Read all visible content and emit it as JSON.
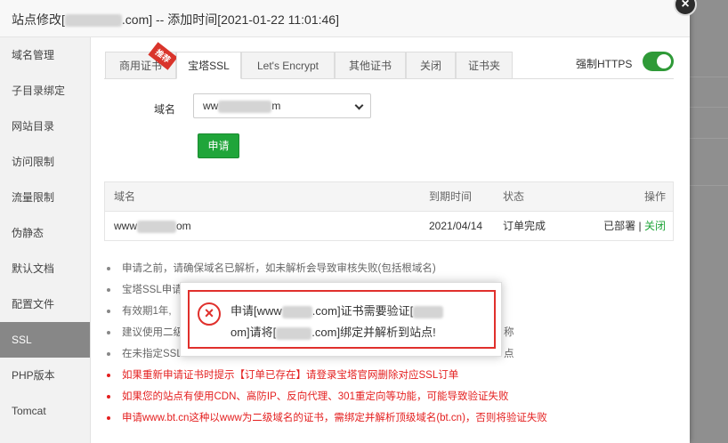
{
  "dialog": {
    "title_prefix": "站点修改[",
    "title_suffix": ".com] -- 添加时间[2021-01-22 11:01:46]",
    "close_glyph": "×"
  },
  "sidebar": {
    "items": [
      {
        "label": "域名管理"
      },
      {
        "label": "子目录绑定"
      },
      {
        "label": "网站目录"
      },
      {
        "label": "访问限制"
      },
      {
        "label": "流量限制"
      },
      {
        "label": "伪静态"
      },
      {
        "label": "默认文档"
      },
      {
        "label": "配置文件"
      },
      {
        "label": "SSL"
      },
      {
        "label": "PHP版本"
      },
      {
        "label": "Tomcat"
      }
    ],
    "active": "SSL"
  },
  "tabs": {
    "items": [
      {
        "label": "商用证书"
      },
      {
        "label": "宝塔SSL"
      },
      {
        "label": "Let's Encrypt"
      },
      {
        "label": "其他证书"
      },
      {
        "label": "关闭"
      },
      {
        "label": "证书夹"
      }
    ],
    "badge": "推荐",
    "active": "宝塔SSL"
  },
  "force_https": {
    "label": "强制HTTPS",
    "enabled": true
  },
  "domain_field": {
    "label": "域名",
    "value_prefix": "ww",
    "value_suffix": "m"
  },
  "apply_button": {
    "label": "申请"
  },
  "table": {
    "headers": {
      "domain": "域名",
      "expire": "到期时间",
      "status": "状态",
      "actions": "操作"
    },
    "rows": [
      {
        "domain_prefix": "www",
        "domain_suffix": "om",
        "expire": "2021/04/14",
        "status": "订单完成",
        "deployed": "已部署",
        "separator": "|",
        "close_link": "关闭"
      }
    ]
  },
  "notes": [
    {
      "text": "申请之前，请确保域名已解析，如未解析会导致审核失败(包括根域名)",
      "red": false
    },
    {
      "text": "宝塔SSL申请",
      "red": false
    },
    {
      "text": "有效期1年,",
      "red": false
    },
    {
      "text": "建议使用二级",
      "tail": "称",
      "red": false
    },
    {
      "text": "在未指定SSL",
      "tail": "点",
      "red": false
    },
    {
      "text": "如果重新申请证书时提示【订单已存在】请登录宝塔官网删除对应SSL订单",
      "red": true
    },
    {
      "text": "如果您的站点有使用CDN、高防IP、反向代理、301重定向等功能，可能导致验证失败",
      "red": true
    },
    {
      "text": "申请www.bt.cn这种以www为二级域名的证书，需绑定并解析顶级域名(bt.cn)，否则将验证失败",
      "red": true
    }
  ],
  "toast": {
    "icon": "×",
    "line1_a": "申请[www",
    "line1_b": ".com]证书需要验证[",
    "line2_a": "om]请将[",
    "line2_b": ".com]绑定并解析到站点!"
  },
  "colors": {
    "accent_green": "#20a53a",
    "error_red": "#e0302c",
    "active_sidebar": "#878787"
  }
}
